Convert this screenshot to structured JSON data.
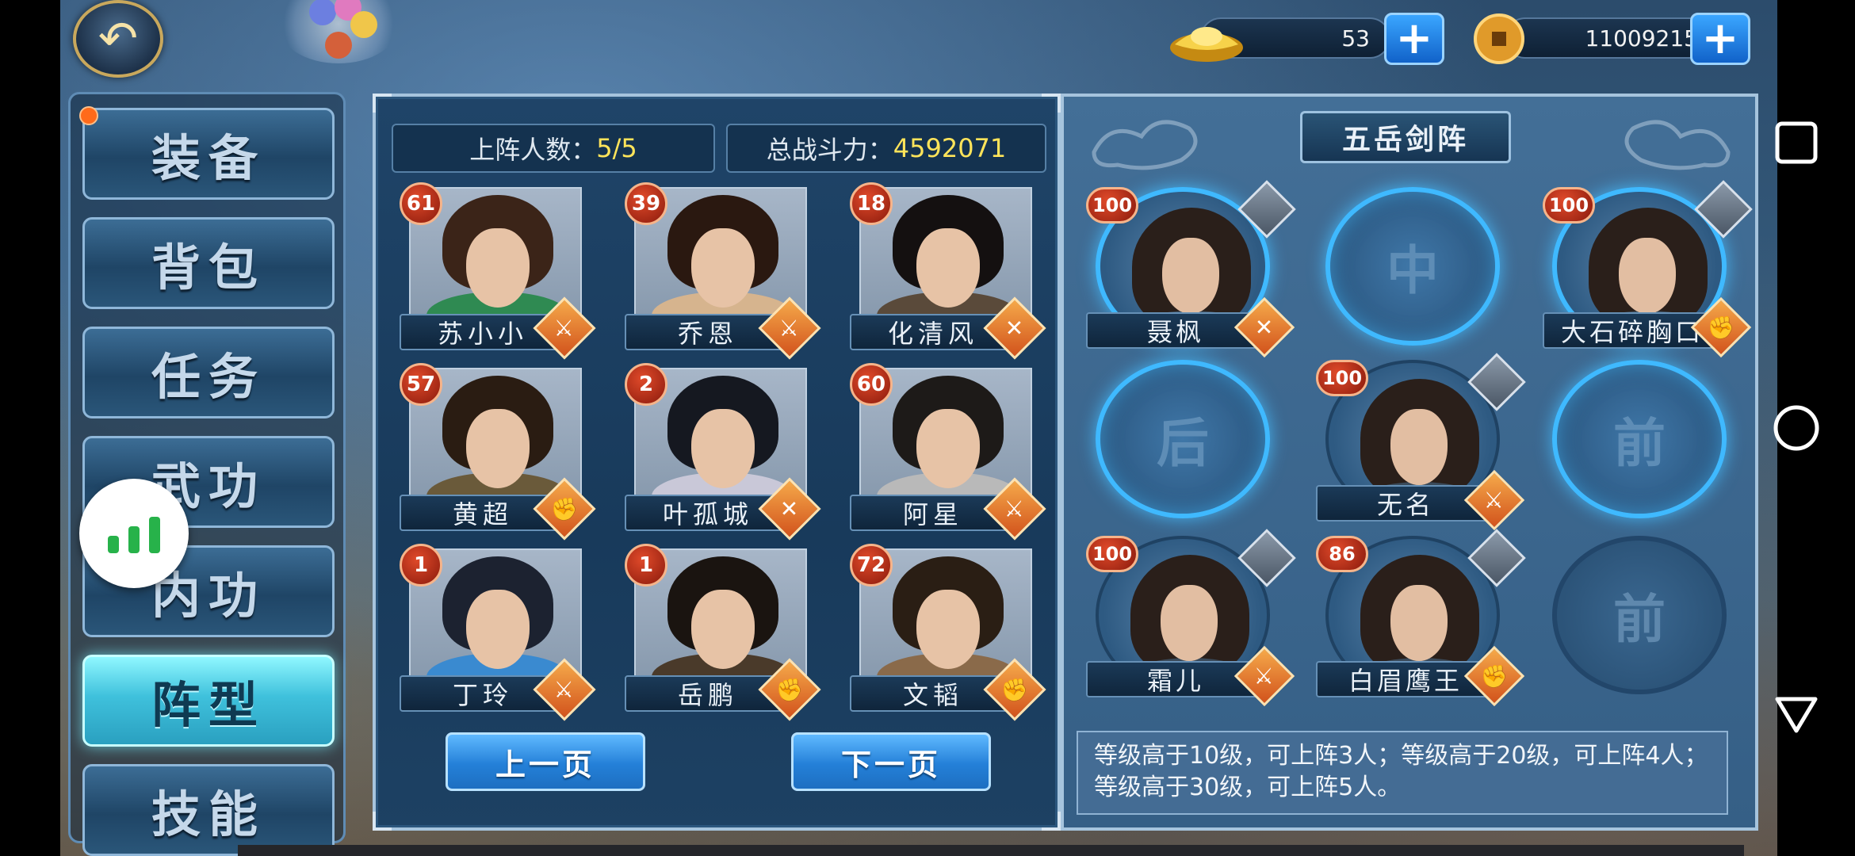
{
  "currency": {
    "gold": {
      "icon": "gold-ingot-icon",
      "value": "53"
    },
    "coin": {
      "icon": "copper-coin-icon",
      "value": "11009215"
    },
    "add_symbol": "+"
  },
  "back_symbol": "↶",
  "tabs": [
    {
      "label": "装备",
      "active": false
    },
    {
      "label": "背包",
      "active": false
    },
    {
      "label": "任务",
      "active": false
    },
    {
      "label": "武功",
      "active": false
    },
    {
      "label": "内功",
      "active": false
    },
    {
      "label": "阵型",
      "active": true
    },
    {
      "label": "技能",
      "active": false
    }
  ],
  "roster": {
    "deployed_label": "上阵人数：",
    "deployed_value": "5/5",
    "power_label": "总战斗力：",
    "power_value": "4592071",
    "heroes": [
      {
        "name": "苏小小",
        "level": "61",
        "class": "sword",
        "class_icon": "sword-icon"
      },
      {
        "name": "乔恩",
        "level": "39",
        "class": "sword",
        "class_icon": "sword-icon"
      },
      {
        "name": "化清风",
        "level": "18",
        "class": "cross-swords",
        "class_icon": "crossed-swords-icon"
      },
      {
        "name": "黄超",
        "level": "57",
        "class": "fist",
        "class_icon": "fist-icon"
      },
      {
        "name": "叶孤城",
        "level": "2",
        "class": "cross-swords",
        "class_icon": "crossed-swords-icon"
      },
      {
        "name": "阿星",
        "level": "60",
        "class": "sword",
        "class_icon": "sword-icon"
      },
      {
        "name": "丁玲",
        "level": "1",
        "class": "sword",
        "class_icon": "sword-icon"
      },
      {
        "name": "岳鹏",
        "level": "1",
        "class": "fist",
        "class_icon": "fist-icon"
      },
      {
        "name": "文韬",
        "level": "72",
        "class": "fist",
        "class_icon": "fist-icon"
      }
    ],
    "prev_page": "上一页",
    "next_page": "下一页"
  },
  "formation": {
    "title": "五岳剑阵",
    "slots": [
      {
        "type": "hero",
        "name": "聂枫",
        "level": "100",
        "class": "cross-swords",
        "lit": true
      },
      {
        "type": "empty",
        "label": "中",
        "lit": true
      },
      {
        "type": "hero",
        "name": "大石碎胸口",
        "level": "100",
        "class": "fist",
        "lit": true
      },
      {
        "type": "empty",
        "label": "后",
        "lit": true
      },
      {
        "type": "hero",
        "name": "无名",
        "level": "100",
        "class": "sword",
        "lit": false
      },
      {
        "type": "empty",
        "label": "前",
        "lit": true
      },
      {
        "type": "hero",
        "name": "霜儿",
        "level": "100",
        "class": "sword",
        "lit": false
      },
      {
        "type": "hero",
        "name": "白眉鹰王",
        "level": "86",
        "class": "fist",
        "lit": false
      },
      {
        "type": "empty",
        "label": "前",
        "lit": false
      }
    ],
    "rule_text": "等级高于10级，可上阵3人；等级高于20级，可上阵4人；等级高于30级，可上阵5人。"
  },
  "class_glyphs": {
    "sword": "⚔",
    "cross-swords": "✕",
    "fist": "✊"
  },
  "colors": {
    "accent_gold": "#ffe45a",
    "active_tab": "#3fc1dc",
    "slot_glow": "#3fb9ff",
    "level_badge": "#c0351c"
  }
}
